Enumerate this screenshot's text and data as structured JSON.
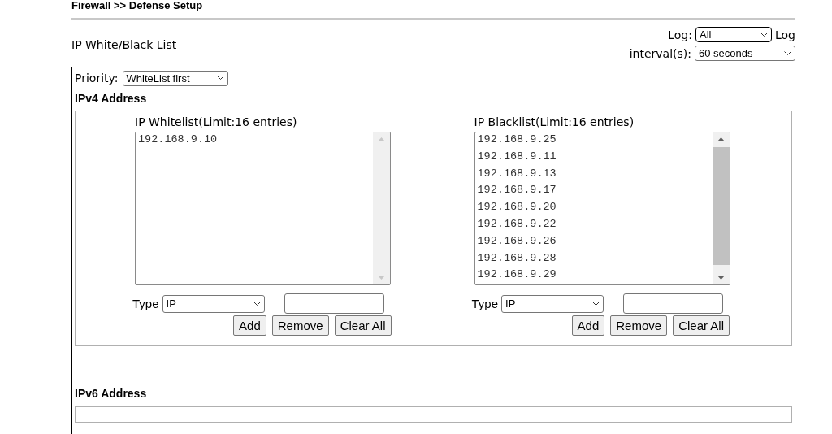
{
  "page_title": "Firewall >> Defense Setup",
  "section_title": "IP White/Black List",
  "log": {
    "label": "Log:",
    "value": "All",
    "interval_label_lines": [
      "Log",
      "interval(s):"
    ],
    "interval_value": "60 seconds"
  },
  "priority": {
    "label": "Priority:",
    "value": "WhiteList first"
  },
  "ipv4": {
    "title": "IPv4 Address",
    "lists": [
      {
        "title": "IP Whitelist(Limit:16 entries)",
        "entries": [
          "192.168.9.10"
        ],
        "type_label": "Type",
        "type_value": "IP",
        "buttons": [
          "Add",
          "Remove",
          "Clear All"
        ]
      },
      {
        "title": "IP Blacklist(Limit:16 entries)",
        "entries": [
          "192.168.9.25",
          "192.168.9.11",
          "192.168.9.13",
          "192.168.9.17",
          "192.168.9.20",
          "192.168.9.22",
          "192.168.9.26",
          "192.168.9.28",
          "192.168.9.29"
        ],
        "type_label": "Type",
        "type_value": "IP",
        "buttons": [
          "Add",
          "Remove",
          "Clear All"
        ]
      }
    ]
  },
  "ipv6": {
    "title": "IPv6 Address"
  }
}
